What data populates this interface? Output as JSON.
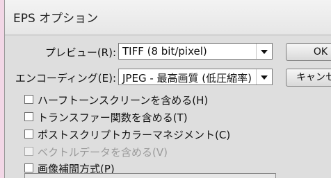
{
  "dialog": {
    "title": "EPS オプション"
  },
  "preview": {
    "label": "プレビュー(R):",
    "value": "TIFF (8 bit/pixel)"
  },
  "encoding": {
    "label": "エンコーディング(E):",
    "value": "JPEG - 最高画質 (低圧縮率)"
  },
  "buttons": {
    "ok": "OK",
    "cancel": "キャンセル"
  },
  "options": [
    {
      "label": "ハーフトーンスクリーンを含める(H)",
      "checked": false,
      "enabled": true
    },
    {
      "label": "トランスファー関数を含める(T)",
      "checked": false,
      "enabled": true
    },
    {
      "label": "ポストスクリプトカラーマネジメント(C)",
      "checked": false,
      "enabled": true
    },
    {
      "label": "ベクトルデータを含める(V)",
      "checked": false,
      "enabled": false
    },
    {
      "label": "画像補間方式(P)",
      "checked": false,
      "enabled": true
    }
  ]
}
